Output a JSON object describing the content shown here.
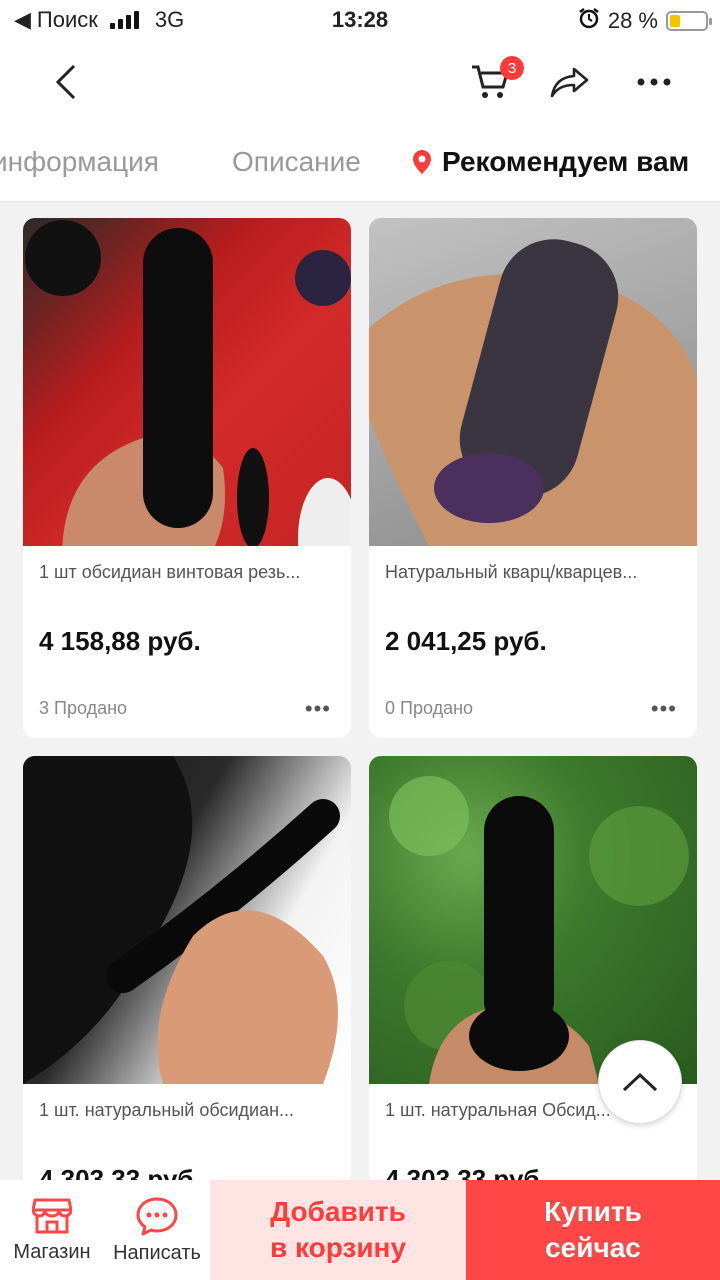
{
  "status_bar": {
    "back_app": "Поиск",
    "network": "3G",
    "time": "13:28",
    "battery": "28 %",
    "battery_level": 0.28
  },
  "nav": {
    "cart_count": "3"
  },
  "tabs": [
    {
      "label": "информация"
    },
    {
      "label": "Описание"
    },
    {
      "label": "Рекомендуем вам"
    }
  ],
  "products": [
    {
      "title": "1 шт обсидиан винтовая резь...",
      "price": "4 158,88 руб.",
      "sold": "3 Продано"
    },
    {
      "title": "Натуральный кварц/кварцев...",
      "price": "2 041,25 руб.",
      "sold": "0 Продано"
    },
    {
      "title": "1 шт. натуральный обсидиан...",
      "price": "4 303,33 руб."
    },
    {
      "title": "1 шт. натуральная Обсид...",
      "price": "4 303,33 руб."
    }
  ],
  "bottom_bar": {
    "store_label": "Магазин",
    "chat_label": "Написать",
    "add_to_cart_line1": "Добавить",
    "add_to_cart_line2": "в корзину",
    "buy_now_line1": "Купить",
    "buy_now_line2": "сейчас"
  },
  "colors": {
    "accent": "#ff4747",
    "accent_light": "#ffe4e4",
    "badge": "#ff3b3b"
  }
}
